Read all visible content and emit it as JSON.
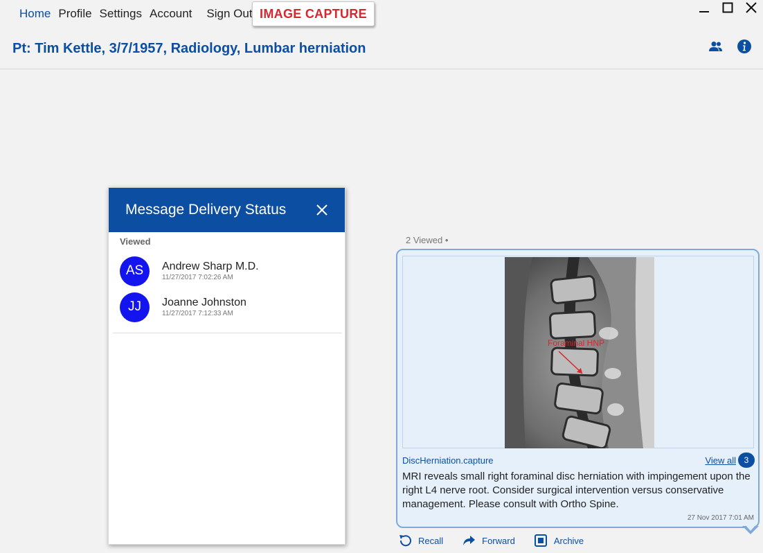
{
  "nav": {
    "items": [
      {
        "label": "Home",
        "active": true
      },
      {
        "label": "Profile"
      },
      {
        "label": "Settings"
      },
      {
        "label": "Account"
      }
    ],
    "sign_out": "Sign Out",
    "capture_button": "IMAGE CAPTURE"
  },
  "window": {
    "icons": [
      "minimize-icon",
      "maximize-icon",
      "close-icon"
    ]
  },
  "header": {
    "patient": "Pt: Tim Kettle, 3/7/1957, Radiology, Lumbar herniation",
    "icons": [
      "users-icon",
      "info-icon"
    ]
  },
  "status_panel": {
    "title": "Message Delivery Status",
    "section": "Viewed",
    "recipients": [
      {
        "initials": "AS",
        "name": "Andrew Sharp M.D.",
        "time": "11/27/2017 7:02:26 AM"
      },
      {
        "initials": "JJ",
        "name": "Joanne Johnston",
        "time": "11/27/2017 7:12:33 AM"
      }
    ]
  },
  "message": {
    "viewed_note": "2 Viewed •",
    "image_annotation": "Foraminal HNP",
    "attachment": "DiscHerniation.capture",
    "view_all": "View all",
    "count": "3",
    "text": "MRI reveals small right foraminal disc herniation with impingement upon the right L4 nerve root. Consider surgical intervention versus conservative management. Please consult with Ortho Spine.",
    "timestamp": "27 Nov 2017 7:01 AM"
  },
  "actions": {
    "recall": "Recall",
    "forward": "Forward",
    "archive": "Archive"
  },
  "colors": {
    "brand": "#0b4ea2",
    "capture_red": "#d7262d",
    "avatar": "#1414ee",
    "bubble": "#e5f0fb"
  }
}
